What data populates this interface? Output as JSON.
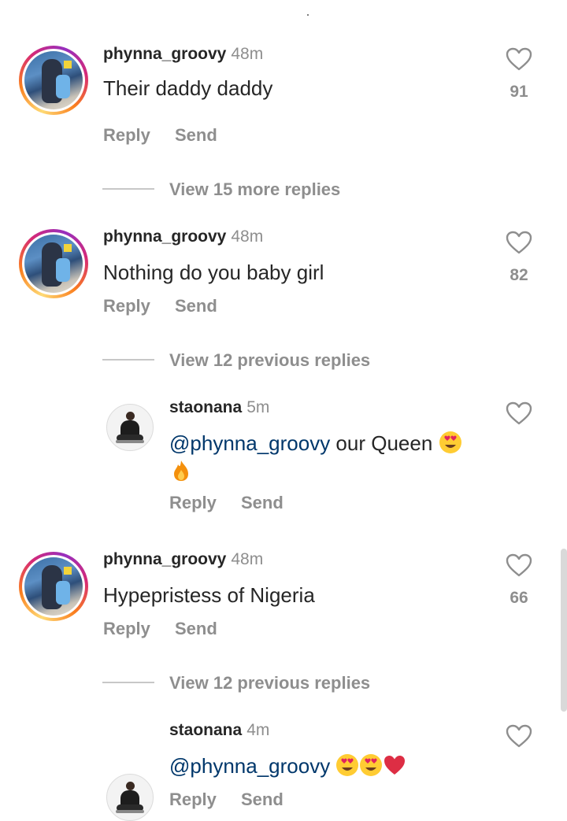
{
  "comments": [
    {
      "username": "phynna_groovy",
      "time": "48m",
      "text": "Their daddy daddy",
      "likes": "91",
      "reply": "Reply",
      "send": "Send",
      "view_more": "View 15 more replies"
    },
    {
      "username": "phynna_groovy",
      "time": "48m",
      "text": "Nothing do you baby girl",
      "likes": "82",
      "reply": "Reply",
      "send": "Send",
      "view_more": "View 12 previous replies",
      "reply_item": {
        "username": "staonana",
        "time": "5m",
        "mention": "@phynna_groovy",
        "text": " our Queen",
        "emojis": [
          "heart-eyes-emoji",
          "fire-emoji"
        ],
        "reply": "Reply",
        "send": "Send"
      }
    },
    {
      "username": "phynna_groovy",
      "time": "48m",
      "text": "Hypepristess of Nigeria",
      "likes": "66",
      "reply": "Reply",
      "send": "Send",
      "view_more": "View 12 previous replies",
      "reply_item": {
        "username": "staonana",
        "time": "4m",
        "mention": "@phynna_groovy",
        "text": " ",
        "emojis": [
          "heart-eyes-emoji",
          "heart-eyes-emoji",
          "red-heart-emoji"
        ],
        "reply": "Reply",
        "send": "Send"
      }
    }
  ],
  "colors": {
    "text": "#262626",
    "secondary": "#8e8e8e",
    "mention": "#00376b"
  }
}
